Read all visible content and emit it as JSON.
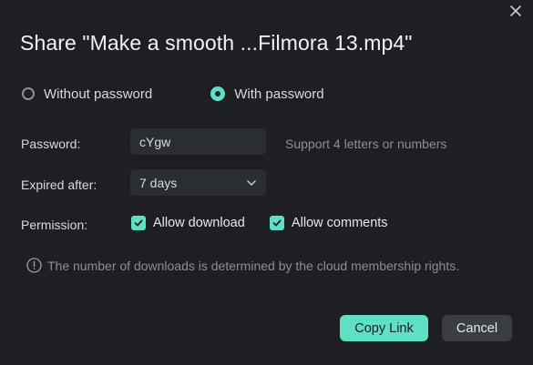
{
  "dialog": {
    "title": "Share \"Make a smooth ...Filmora 13.mp4\"",
    "close_icon": "close-icon"
  },
  "password_mode": {
    "options": [
      {
        "label": "Without password",
        "selected": false
      },
      {
        "label": "With password",
        "selected": true
      }
    ]
  },
  "form": {
    "password_label": "Password:",
    "password_value": "cYgw",
    "password_hint": "Support 4 letters or numbers",
    "expired_label": "Expired after:",
    "expired_value": "7 days",
    "permission_label": "Permission:",
    "permissions": [
      {
        "label": "Allow download",
        "checked": true
      },
      {
        "label": "Allow comments",
        "checked": true
      }
    ]
  },
  "info": {
    "icon": "info-icon",
    "text": "The number of downloads is determined by the cloud membership rights."
  },
  "buttons": {
    "copy_link": "Copy Link",
    "cancel": "Cancel"
  },
  "colors": {
    "accent": "#5fe0c4",
    "background": "#1d1f23",
    "field": "#2a2d32",
    "secondary_button": "#3a3d43"
  }
}
